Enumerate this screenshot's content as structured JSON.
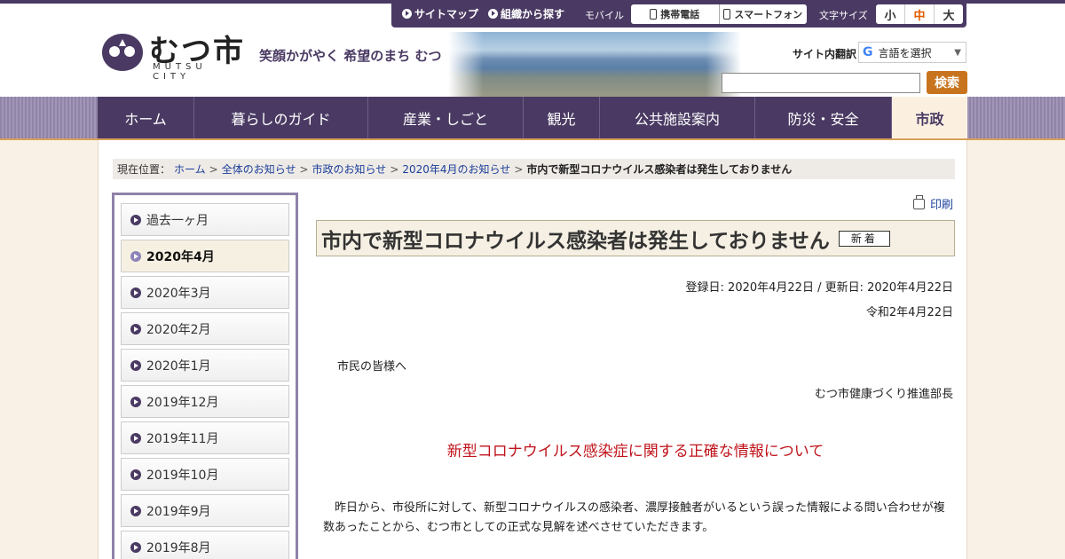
{
  "header": {
    "logo_text": "むつ市",
    "logo_sub": "MUTSU CITY",
    "tagline": "笑顔かがやく 希望のまち むつ"
  },
  "util": {
    "sitemap": "サイトマップ",
    "org": "組織から探す",
    "mobile_label": "モバイル",
    "mobile_phone": "携帯電話",
    "smartphone": "スマートフォン",
    "fontsize_label": "文字サイズ",
    "sizes": [
      "小",
      "中",
      "大"
    ]
  },
  "translate": {
    "label": "サイト内翻訳",
    "select": "言語を選択"
  },
  "search": {
    "value": "",
    "button": "検索"
  },
  "nav": [
    {
      "label": "ホーム"
    },
    {
      "label": "暮らしのガイド"
    },
    {
      "label": "産業・しごと"
    },
    {
      "label": "観光"
    },
    {
      "label": "公共施設案内"
    },
    {
      "label": "防災・安全"
    },
    {
      "label": "市政"
    }
  ],
  "breadcrumb": {
    "prefix": "現在位置：",
    "links": [
      "ホーム",
      "全体のお知らせ",
      "市政のお知らせ",
      "2020年4月のお知らせ"
    ],
    "current": "市内で新型コロナウイルス感染者は発生しておりません"
  },
  "sidebar": {
    "items": [
      {
        "label": "過去一ヶ月"
      },
      {
        "label": "2020年4月"
      },
      {
        "label": "2020年3月"
      },
      {
        "label": "2020年2月"
      },
      {
        "label": "2020年1月"
      },
      {
        "label": "2019年12月"
      },
      {
        "label": "2019年11月"
      },
      {
        "label": "2019年10月"
      },
      {
        "label": "2019年9月"
      },
      {
        "label": "2019年8月"
      }
    ]
  },
  "article": {
    "print": "印刷",
    "title": "市内で新型コロナウイルス感染者は発生しておりません",
    "badge": "新着",
    "dates": "登録日: 2020年4月22日 /  更新日: 2020年4月22日",
    "date": "令和2年4月22日",
    "greeting": "市民の皆様へ",
    "sender": "むつ市健康づくり推進部長",
    "headline": "新型コロナウイルス感染症に関する正確な情報について",
    "body": "昨日から、市役所に対して、新型コロナウイルスの感染者、濃厚接触者がいるという誤った情報による問い合わせが複数あったことから、むつ市としての正式な見解を述べさせていただきます。"
  },
  "colors": {
    "brand": "#4a3a63",
    "accent": "#c8741e",
    "headline": "#c0141c"
  }
}
